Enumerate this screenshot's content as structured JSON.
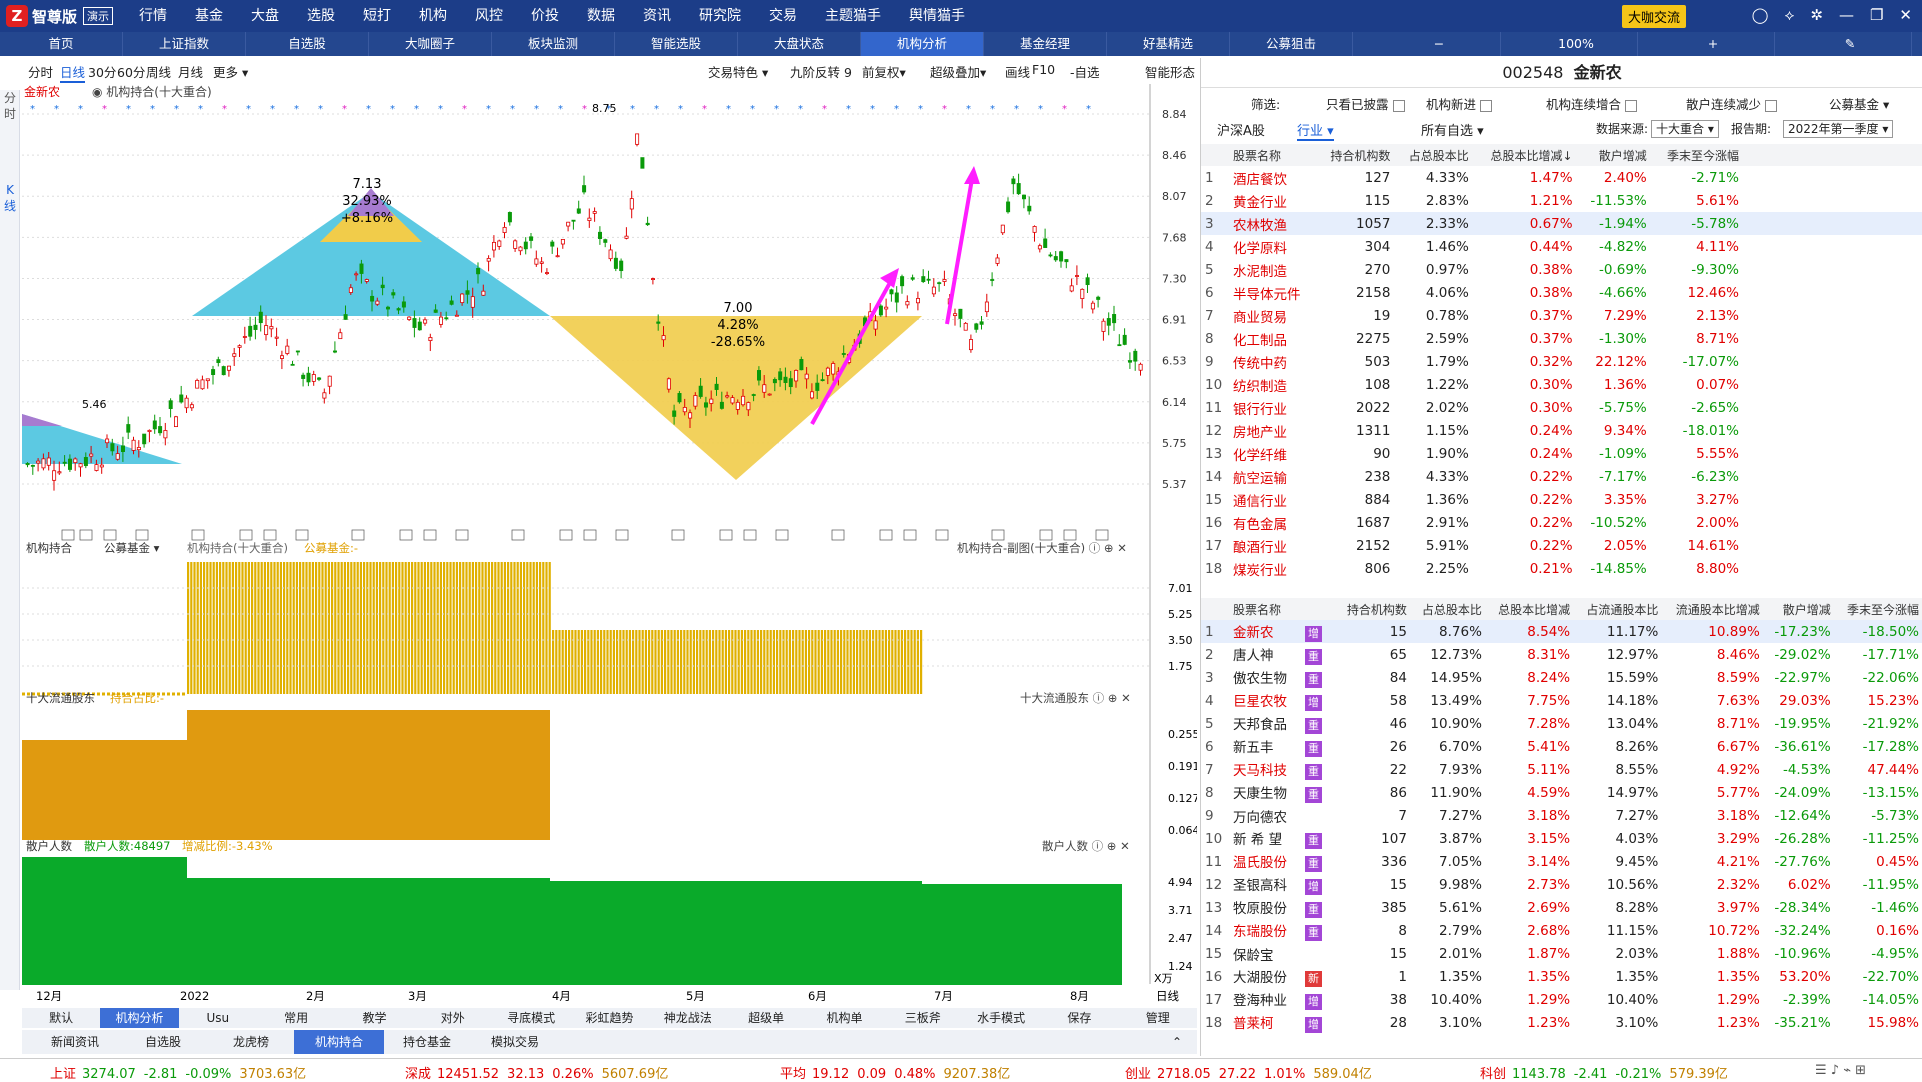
{
  "app": {
    "name": "智尊版",
    "demo": "演示",
    "menu": [
      "行情",
      "基金",
      "大盘",
      "选股",
      "短打",
      "机构",
      "风控",
      "价投",
      "数据",
      "资讯",
      "研究院",
      "交易",
      "主题猫手",
      "舆情猫手"
    ],
    "dk": "大咖交流"
  },
  "tabs": [
    "首页",
    "上证指数",
    "自选股",
    "大咖圈子",
    "板块监测",
    "智能选股",
    "大盘状态",
    "机构分析",
    "基金经理",
    "好基精选",
    "公募狙击"
  ],
  "zoom": "100%",
  "left_strip": [
    "分",
    "时",
    "K",
    "线"
  ],
  "period": {
    "items": [
      "分时",
      "日线",
      "30分",
      "60分",
      "周线",
      "月线",
      "更多 ▾"
    ],
    "right": [
      "交易特色 ▾",
      "九阶反转 9",
      "前复权▾",
      "超级叠加▾",
      "画线",
      "F10",
      "-自选",
      "智能形态"
    ]
  },
  "chart": {
    "main_label": "金新农",
    "main_sub": "机构持合(十大重合)",
    "price_ticks": [
      "8.84",
      "8.46",
      "8.07",
      "7.68",
      "7.30",
      "6.91",
      "6.53",
      "6.14",
      "5.75",
      "5.37"
    ],
    "high": "8.75",
    "low": "5.46",
    "tri1": [
      "7.13",
      "32.93%",
      "+8.16%"
    ],
    "tri2": [
      "7.00",
      "4.28%",
      "-28.65%"
    ],
    "sub1": {
      "labels": [
        "机构持合",
        "公募基金 ▾",
        "机构持合(十大重合)",
        "公募基金:-"
      ],
      "right": "机构持合-副图(十大重合)",
      "ticks": [
        "7.01",
        "5.25",
        "3.50",
        "1.75"
      ]
    },
    "sub2": {
      "labels": [
        "十大流通股东",
        "持合占比:-"
      ],
      "right": "十大流通股东",
      "ticks": [
        "0.255",
        "0.191",
        "0.127",
        "0.064"
      ]
    },
    "sub3": {
      "labels": [
        "散户人数",
        "散户人数:48497",
        "增减比例:-3.43%"
      ],
      "right": "散户人数",
      "ticks": [
        "4.94",
        "3.71",
        "2.47",
        "1.24"
      ],
      "unit": "X万"
    },
    "months": [
      "12月",
      "2022",
      "2月",
      "3月",
      "4月",
      "5月",
      "6月",
      "7月",
      "8月"
    ],
    "daily": "日线"
  },
  "bottom_tabs": [
    "默认",
    "机构分析",
    "Usu",
    "常用",
    "教学",
    "对外",
    "寻底模式",
    "彩虹趋势",
    "神龙战法",
    "超级单",
    "机构单",
    "三板斧",
    "水手模式",
    "保存",
    "管理"
  ],
  "news_tabs": [
    "新闻资讯",
    "自选股",
    "龙虎榜",
    "机构持合",
    "持仓基金",
    "模拟交易"
  ],
  "status": [
    {
      "name": "上证",
      "v": "3274.07",
      "c": "-2.81",
      "p": "-0.09%",
      "a": "3703.63亿"
    },
    {
      "name": "深成",
      "v": "12451.52",
      "c": "32.13",
      "p": "0.26%",
      "a": "5607.69亿"
    },
    {
      "name": "平均",
      "v": "19.12",
      "c": "0.09",
      "p": "0.48%",
      "a": "9207.38亿"
    },
    {
      "name": "创业",
      "v": "2718.05",
      "c": "27.22",
      "p": "1.01%",
      "a": "589.04亿"
    },
    {
      "name": "科创",
      "v": "1143.78",
      "c": "-2.41",
      "p": "-0.21%",
      "a": "579.39亿"
    }
  ],
  "right": {
    "code": "002548",
    "name": "金新农",
    "filter_label": "筛选:",
    "filters": [
      "只看已披露",
      "机构新进",
      "机构连续增合",
      "散户连续减少"
    ],
    "fund": "公募基金 ▾",
    "tabs": [
      "沪深A股",
      "行业 ▾",
      "所有自选 ▾"
    ],
    "src_label": "数据来源:",
    "src": "十大重合 ▾",
    "rep_label": "报告期:",
    "rep": "2022年第一季度 ▾",
    "t1_head": [
      "股票名称",
      "持合机构数",
      "占总股本比",
      "总股本比增减↓",
      "散户增减",
      "季末至今涨幅"
    ],
    "t1": [
      [
        "1",
        "酒店餐饮",
        "127",
        "4.33%",
        "1.47%",
        "2.40%",
        "-2.71%"
      ],
      [
        "2",
        "黄金行业",
        "115",
        "2.83%",
        "1.21%",
        "-11.53%",
        "5.61%"
      ],
      [
        "3",
        "农林牧渔",
        "1057",
        "2.33%",
        "0.67%",
        "-1.94%",
        "-5.78%"
      ],
      [
        "4",
        "化学原料",
        "304",
        "1.46%",
        "0.44%",
        "-4.82%",
        "4.11%"
      ],
      [
        "5",
        "水泥制造",
        "270",
        "0.97%",
        "0.38%",
        "-0.69%",
        "-9.30%"
      ],
      [
        "6",
        "半导体元件",
        "2158",
        "4.06%",
        "0.38%",
        "-4.66%",
        "12.46%"
      ],
      [
        "7",
        "商业贸易",
        "19",
        "0.78%",
        "0.37%",
        "7.29%",
        "2.13%"
      ],
      [
        "8",
        "化工制品",
        "2275",
        "2.59%",
        "0.37%",
        "-1.30%",
        "8.71%"
      ],
      [
        "9",
        "传统中药",
        "503",
        "1.79%",
        "0.32%",
        "22.12%",
        "-17.07%"
      ],
      [
        "10",
        "纺织制造",
        "108",
        "1.22%",
        "0.30%",
        "1.36%",
        "0.07%"
      ],
      [
        "11",
        "银行行业",
        "2022",
        "2.02%",
        "0.30%",
        "-5.75%",
        "-2.65%"
      ],
      [
        "12",
        "房地产业",
        "1311",
        "1.15%",
        "0.24%",
        "9.34%",
        "-18.01%"
      ],
      [
        "13",
        "化学纤维",
        "90",
        "1.90%",
        "0.24%",
        "-1.09%",
        "5.55%"
      ],
      [
        "14",
        "航空运输",
        "238",
        "4.33%",
        "0.22%",
        "-7.17%",
        "-6.23%"
      ],
      [
        "15",
        "通信行业",
        "884",
        "1.36%",
        "0.22%",
        "3.35%",
        "3.27%"
      ],
      [
        "16",
        "有色金属",
        "1687",
        "2.91%",
        "0.22%",
        "-10.52%",
        "2.00%"
      ],
      [
        "17",
        "酿酒行业",
        "2152",
        "5.91%",
        "0.22%",
        "2.05%",
        "14.61%"
      ],
      [
        "18",
        "煤炭行业",
        "806",
        "2.25%",
        "0.21%",
        "-14.85%",
        "8.80%"
      ]
    ],
    "t2_head": [
      "股票名称",
      "持合机构数",
      "占总股本比",
      "总股本比增减",
      "占流通股本比",
      "流通股本比增减",
      "散户增减",
      "季末至今涨幅"
    ],
    "t2": [
      [
        "1",
        "金新农",
        "增",
        "15",
        "8.76%",
        "8.54%",
        "11.17%",
        "10.89%",
        "-17.23%",
        "-18.50%"
      ],
      [
        "2",
        "唐人神",
        "重",
        "65",
        "12.73%",
        "8.31%",
        "12.97%",
        "8.46%",
        "-29.02%",
        "-17.71%"
      ],
      [
        "3",
        "傲农生物",
        "重",
        "84",
        "14.95%",
        "8.24%",
        "15.59%",
        "8.59%",
        "-22.97%",
        "-22.06%"
      ],
      [
        "4",
        "巨星农牧",
        "增",
        "58",
        "13.49%",
        "7.75%",
        "14.18%",
        "7.63%",
        "29.03%",
        "15.23%"
      ],
      [
        "5",
        "天邦食品",
        "重",
        "46",
        "10.90%",
        "7.28%",
        "13.04%",
        "8.71%",
        "-19.95%",
        "-21.92%"
      ],
      [
        "6",
        "新五丰",
        "重",
        "26",
        "6.70%",
        "5.41%",
        "8.26%",
        "6.67%",
        "-36.61%",
        "-17.28%"
      ],
      [
        "7",
        "天马科技",
        "重",
        "22",
        "7.93%",
        "5.11%",
        "8.55%",
        "4.92%",
        "-4.53%",
        "47.44%"
      ],
      [
        "8",
        "天康生物",
        "重",
        "86",
        "11.90%",
        "4.59%",
        "14.97%",
        "5.77%",
        "-24.09%",
        "-13.15%"
      ],
      [
        "9",
        "万向德农",
        "",
        "7",
        "7.27%",
        "3.18%",
        "7.27%",
        "3.18%",
        "-12.64%",
        "-5.73%"
      ],
      [
        "10",
        "新 希 望",
        "重",
        "107",
        "3.87%",
        "3.15%",
        "4.03%",
        "3.29%",
        "-26.28%",
        "-11.25%"
      ],
      [
        "11",
        "温氏股份",
        "重",
        "336",
        "7.05%",
        "3.14%",
        "9.45%",
        "4.21%",
        "-27.76%",
        "0.45%"
      ],
      [
        "12",
        "圣银高科",
        "增",
        "15",
        "9.98%",
        "2.73%",
        "10.56%",
        "2.32%",
        "6.02%",
        "-11.95%"
      ],
      [
        "13",
        "牧原股份",
        "重",
        "385",
        "5.61%",
        "2.69%",
        "8.28%",
        "3.97%",
        "-28.34%",
        "-1.46%"
      ],
      [
        "14",
        "东瑞股份",
        "重",
        "8",
        "2.79%",
        "2.68%",
        "11.15%",
        "10.72%",
        "-32.24%",
        "0.16%"
      ],
      [
        "15",
        "保龄宝",
        "",
        "15",
        "2.01%",
        "1.87%",
        "2.03%",
        "1.88%",
        "-10.96%",
        "-4.95%"
      ],
      [
        "16",
        "大湖股份",
        "新",
        "1",
        "1.35%",
        "1.35%",
        "1.35%",
        "1.35%",
        "53.20%",
        "-22.70%"
      ],
      [
        "17",
        "登海种业",
        "增",
        "38",
        "10.40%",
        "1.29%",
        "10.40%",
        "1.29%",
        "-2.39%",
        "-14.05%"
      ],
      [
        "18",
        "普莱柯",
        "增",
        "28",
        "3.10%",
        "1.23%",
        "3.10%",
        "1.23%",
        "-35.21%",
        "15.98%"
      ]
    ]
  }
}
